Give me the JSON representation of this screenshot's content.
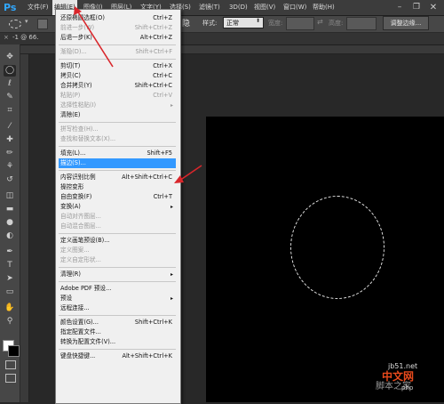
{
  "app": {
    "logo": "Ps"
  },
  "menubar": {
    "items": [
      "文件(F)",
      "编辑(E)",
      "图像(I)",
      "图层(L)",
      "文字(Y)",
      "选择(S)",
      "滤镜(T)",
      "3D(D)",
      "视图(V)",
      "窗口(W)",
      "帮助(H)"
    ],
    "active_index": 1,
    "window_controls": {
      "minimize": "–",
      "maximize": "❐",
      "close": "✕"
    }
  },
  "options_bar": {
    "style_label": "样式:",
    "style_value": "正常",
    "width_label": "宽度:",
    "height_label": "高度:",
    "refine_edge_button": "调整边缘...",
    "partial_text": "隐"
  },
  "document_tab": {
    "label": "-1 @ 66.",
    "close": "×"
  },
  "edit_menu": {
    "items": [
      {
        "label": "还原椭圆选框(O)",
        "shortcut": "Ctrl+Z",
        "disabled": false
      },
      {
        "label": "前进一步(W)",
        "shortcut": "Shift+Ctrl+Z",
        "disabled": true
      },
      {
        "label": "后退一步(K)",
        "shortcut": "Alt+Ctrl+Z",
        "disabled": false
      },
      {
        "sep": true
      },
      {
        "label": "渐隐(D)...",
        "shortcut": "Shift+Ctrl+F",
        "disabled": true
      },
      {
        "sep": true
      },
      {
        "label": "剪切(T)",
        "shortcut": "Ctrl+X",
        "disabled": false
      },
      {
        "label": "拷贝(C)",
        "shortcut": "Ctrl+C",
        "disabled": false
      },
      {
        "label": "合并拷贝(Y)",
        "shortcut": "Shift+Ctrl+C",
        "disabled": false
      },
      {
        "label": "粘贴(P)",
        "shortcut": "Ctrl+V",
        "disabled": true
      },
      {
        "label": "选择性粘贴(I)",
        "shortcut": "",
        "disabled": true,
        "submenu": true
      },
      {
        "label": "清除(E)",
        "shortcut": "",
        "disabled": false
      },
      {
        "sep": true
      },
      {
        "label": "拼写检查(H)...",
        "shortcut": "",
        "disabled": true
      },
      {
        "label": "查找和替换文本(X)...",
        "shortcut": "",
        "disabled": true
      },
      {
        "sep": true
      },
      {
        "label": "填充(L)...",
        "shortcut": "Shift+F5",
        "disabled": false
      },
      {
        "label": "描边(S)...",
        "shortcut": "",
        "disabled": false,
        "highlighted": true
      },
      {
        "sep": true
      },
      {
        "label": "内容识别比例",
        "shortcut": "Alt+Shift+Ctrl+C",
        "disabled": false
      },
      {
        "label": "操控变形",
        "shortcut": "",
        "disabled": false
      },
      {
        "label": "自由变换(F)",
        "shortcut": "Ctrl+T",
        "disabled": false
      },
      {
        "label": "变换(A)",
        "shortcut": "",
        "disabled": false,
        "submenu": true
      },
      {
        "label": "自动对齐图层...",
        "shortcut": "",
        "disabled": true
      },
      {
        "label": "自动混合图层...",
        "shortcut": "",
        "disabled": true
      },
      {
        "sep": true
      },
      {
        "label": "定义画笔预设(B)...",
        "shortcut": "",
        "disabled": false
      },
      {
        "label": "定义图案...",
        "shortcut": "",
        "disabled": true
      },
      {
        "label": "定义自定形状...",
        "shortcut": "",
        "disabled": true
      },
      {
        "sep": true
      },
      {
        "label": "清理(R)",
        "shortcut": "",
        "disabled": false,
        "submenu": true
      },
      {
        "sep": true
      },
      {
        "label": "Adobe PDF 预设...",
        "shortcut": "",
        "disabled": false
      },
      {
        "label": "预设",
        "shortcut": "",
        "disabled": false,
        "submenu": true
      },
      {
        "label": "远程连接...",
        "shortcut": "",
        "disabled": false
      },
      {
        "sep": true
      },
      {
        "label": "颜色设置(G)...",
        "shortcut": "Shift+Ctrl+K",
        "disabled": false
      },
      {
        "label": "指定配置文件...",
        "shortcut": "",
        "disabled": false
      },
      {
        "label": "转换为配置文件(V)...",
        "shortcut": "",
        "disabled": false
      },
      {
        "sep": true
      },
      {
        "label": "键盘快捷键...",
        "shortcut": "Alt+Shift+Ctrl+K",
        "disabled": false
      }
    ]
  },
  "toolbar": {
    "tools": [
      "move-tool",
      "elliptical-marquee-tool",
      "lasso-tool",
      "quick-selection-tool",
      "crop-tool",
      "eyedropper-tool",
      "spot-healing-tool",
      "brush-tool",
      "clone-stamp-tool",
      "history-brush-tool",
      "eraser-tool",
      "gradient-tool",
      "blur-tool",
      "dodge-tool",
      "pen-tool",
      "type-tool",
      "path-selection-tool",
      "rectangle-tool",
      "hand-tool",
      "zoom-tool"
    ],
    "glyphs": [
      "✥",
      "◯",
      "ℓ",
      "✎",
      "⌗",
      "⁄",
      "✚",
      "✏",
      "⚘",
      "↺",
      "◫",
      "▬",
      "●",
      "◐",
      "✒",
      "T",
      "➤",
      "▭",
      "✋",
      "⚲"
    ],
    "selected_index": 1
  },
  "watermark": {
    "url": "jb51.net",
    "cn": "中文网",
    "cn2": "脚本之家",
    "site": "php"
  },
  "colors": {
    "accent": "#3399ff",
    "arrow": "#d9262b",
    "menu_bg": "#f0f0f0"
  }
}
